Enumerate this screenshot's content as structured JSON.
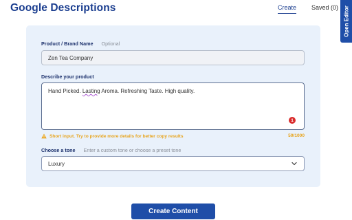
{
  "header": {
    "title": "Google Descriptions",
    "tabs": [
      {
        "label": "Create",
        "active": true
      },
      {
        "label": "Saved (0)",
        "active": false
      }
    ],
    "open_editor_label": "Open Editor"
  },
  "form": {
    "product": {
      "label": "Product / Brand Name",
      "hint": "Optional",
      "value": "Zen Tea Company"
    },
    "description": {
      "label": "Describe your product",
      "value_before": "Hand Picked. ",
      "value_misspelled": "Lasting",
      "value_after": " Aroma. Refreshing Taste. High quality.",
      "error_count": "1",
      "warning": "Short input. Try to provide more details for better copy results",
      "char_count": "59/1000"
    },
    "tone": {
      "label": "Choose a tone",
      "hint": "Enter a custom tone or choose a preset tone",
      "selected": "Luxury"
    }
  },
  "actions": {
    "create_label": "Create Content"
  },
  "colors": {
    "brand": "#1f4ea8",
    "title": "#1a3d8f",
    "panel": "#e9f1fb",
    "warning": "#e8a41c",
    "error": "#d92b2b"
  },
  "icons": {
    "warning": "warning-triangle-icon",
    "chevron": "chevron-down-icon",
    "error": "error-count-icon"
  }
}
